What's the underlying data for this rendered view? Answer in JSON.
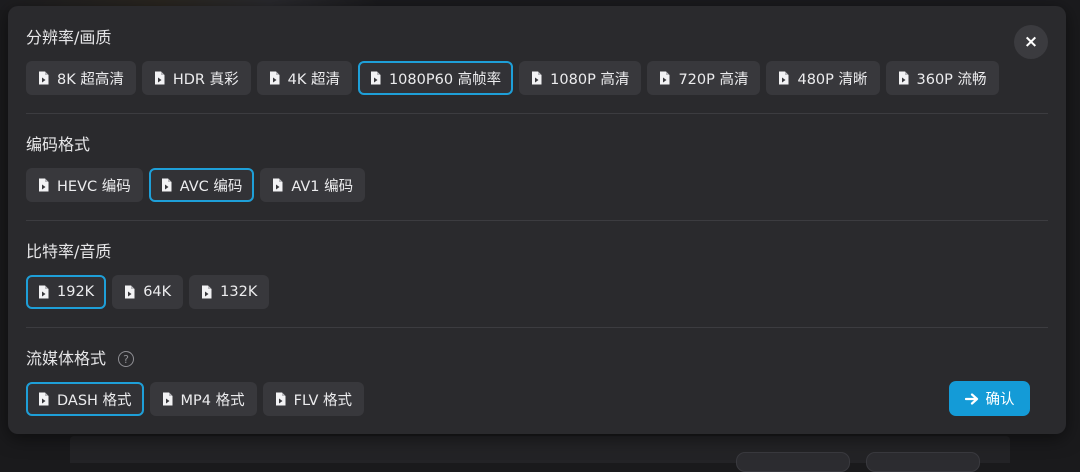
{
  "dialog": {
    "close_label": "×",
    "confirm_label": "确认"
  },
  "sections": {
    "resolution": {
      "title": "分辨率/画质",
      "options": [
        "8K 超高清",
        "HDR 真彩",
        "4K 超清",
        "1080P60 高帧率",
        "1080P 高清",
        "720P 高清",
        "480P 清晰",
        "360P 流畅"
      ],
      "selected": "1080P60 高帧率"
    },
    "codec": {
      "title": "编码格式",
      "options": [
        "HEVC 编码",
        "AVC 编码",
        "AV1 编码"
      ],
      "selected": "AVC 编码"
    },
    "bitrate": {
      "title": "比特率/音质",
      "options": [
        "192K",
        "64K",
        "132K"
      ],
      "selected": "192K"
    },
    "stream": {
      "title": "流媒体格式",
      "help_label": "?",
      "options": [
        "DASH 格式",
        "MP4 格式",
        "FLV 格式"
      ],
      "selected": "DASH 格式"
    }
  },
  "icons": {
    "option": "file-icon",
    "confirm": "arrow-right-icon",
    "close": "close-icon",
    "help": "help-icon"
  },
  "colors": {
    "accent": "#1e9fd8",
    "confirm_bg": "#149bd7",
    "dialog_bg": "#2a2a2d",
    "chip_bg": "#38383c"
  }
}
